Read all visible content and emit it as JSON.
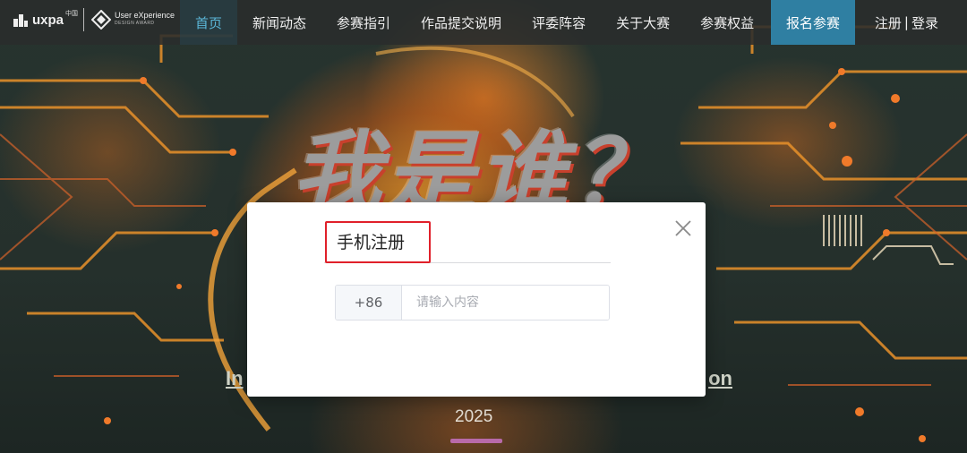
{
  "brand": {
    "uxpa_word": "uxpa",
    "uxpa_cn": "中国",
    "ux_title": "User eXperience",
    "ux_subtitle": "DESIGN AWARD"
  },
  "nav": {
    "items": [
      {
        "label": "首页",
        "active": true
      },
      {
        "label": "新闻动态"
      },
      {
        "label": "参赛指引"
      },
      {
        "label": "作品提交说明"
      },
      {
        "label": "评委阵容"
      },
      {
        "label": "关于大赛"
      },
      {
        "label": "参赛权益"
      }
    ],
    "cta_label": "报名参赛",
    "register_label": "注册",
    "separator": "|",
    "login_label": "登录",
    "accent_color": "#2f7fa2",
    "active_color": "#5bb7d8"
  },
  "hero": {
    "title": "我是谁？",
    "subtitle_left": "In",
    "subtitle_right": "on",
    "year": "2025"
  },
  "modal": {
    "title": "手机注册",
    "phone_prefix": "+86",
    "phone_placeholder": "请输入内容",
    "phone_value": "",
    "close_icon": "close-icon",
    "highlight_color": "#e0202a"
  }
}
